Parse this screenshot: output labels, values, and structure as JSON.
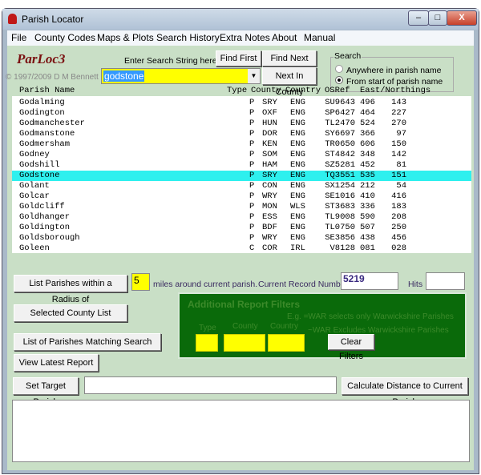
{
  "window": {
    "title": "Parish Locator",
    "minimize": "–",
    "maximize": "□",
    "close": "X"
  },
  "menu": [
    "File",
    "County Codes",
    "Maps & Plots",
    "Search History",
    "Extra Notes",
    "About",
    "Manual"
  ],
  "app": {
    "logo": "ParLoc3",
    "copyright": "© 1997/2009  D M Bennett"
  },
  "search": {
    "prompt": "Enter Search String here.",
    "value": "godstone",
    "find_first": "Find First",
    "find_next": "Find  Next",
    "next_in_county": "Next In County",
    "group_label": "Search",
    "options": [
      {
        "label": "Anywhere in parish name",
        "selected": false
      },
      {
        "label": "From start of parish name",
        "selected": true
      }
    ]
  },
  "list": {
    "headers": {
      "name": "Parish Name",
      "type": "Type",
      "county": "County",
      "country": "Country",
      "osref": "OSRef",
      "en": "East/Northings"
    },
    "selected_index": 7,
    "rows": [
      [
        "Godalming",
        "P",
        "SRY",
        "ENG",
        "SU9643",
        "496",
        "143"
      ],
      [
        "Godington",
        "P",
        "OXF",
        "ENG",
        "SP6427",
        "464",
        "227"
      ],
      [
        "Godmanchester",
        "P",
        "HUN",
        "ENG",
        "TL2470",
        "524",
        "270"
      ],
      [
        "Godmanstone",
        "P",
        "DOR",
        "ENG",
        "SY6697",
        "366",
        "97"
      ],
      [
        "Godmersham",
        "P",
        "KEN",
        "ENG",
        "TR0650",
        "606",
        "150"
      ],
      [
        "Godney",
        "P",
        "SOM",
        "ENG",
        "ST4842",
        "348",
        "142"
      ],
      [
        "Godshill",
        "P",
        "HAM",
        "ENG",
        "SZ5281",
        "452",
        "81"
      ],
      [
        "Godstone",
        "P",
        "SRY",
        "ENG",
        "TQ3551",
        "535",
        "151"
      ],
      [
        "Golant",
        "P",
        "CON",
        "ENG",
        "SX1254",
        "212",
        "54"
      ],
      [
        "Golcar",
        "P",
        "WRY",
        "ENG",
        "SE1016",
        "410",
        "416"
      ],
      [
        "Goldcliff",
        "P",
        "MON",
        "WLS",
        "ST3683",
        "336",
        "183"
      ],
      [
        "Goldhanger",
        "P",
        "ESS",
        "ENG",
        "TL9008",
        "590",
        "208"
      ],
      [
        "Goldington",
        "P",
        "BDF",
        "ENG",
        "TL0750",
        "507",
        "250"
      ],
      [
        "Goldsborough",
        "P",
        "WRY",
        "ENG",
        "SE3856",
        "438",
        "456"
      ],
      [
        "Goleen",
        "C",
        "COR",
        "IRL",
        "V8128",
        "081",
        "028"
      ]
    ]
  },
  "radius": {
    "button": "List Parishes within a Radius of",
    "value": "5",
    "suffix": "miles around current parish.",
    "record_label": "Current Record Number",
    "record_value": "5219",
    "hits_label": "Hits",
    "hits_value": ""
  },
  "buttons": {
    "county_list": "Selected County List",
    "matching": "List of Parishes Matching Search String",
    "latest": "View Latest Report",
    "set_target": "Set Target Parish",
    "calc": "Calculate Distance to Current Parish"
  },
  "filters": {
    "title": "Additional Report Filters",
    "hint1": "E.g. =WAR selects only Warwickshire Parishes",
    "hint2": "~WAR Excludes Warwickshire Parishes",
    "type": "Type",
    "county": "County",
    "country": "Country",
    "clear": "Clear Filters",
    "type_value": "",
    "county_value": "",
    "country_value": ""
  },
  "target": {
    "value": ""
  },
  "report": {
    "value": ""
  },
  "colors": {
    "background": "#c9dfc6",
    "highlight": "#2ef0ee",
    "input": "#ffff00",
    "filter_panel": "#0a6a0a",
    "logo": "#7a1010"
  }
}
